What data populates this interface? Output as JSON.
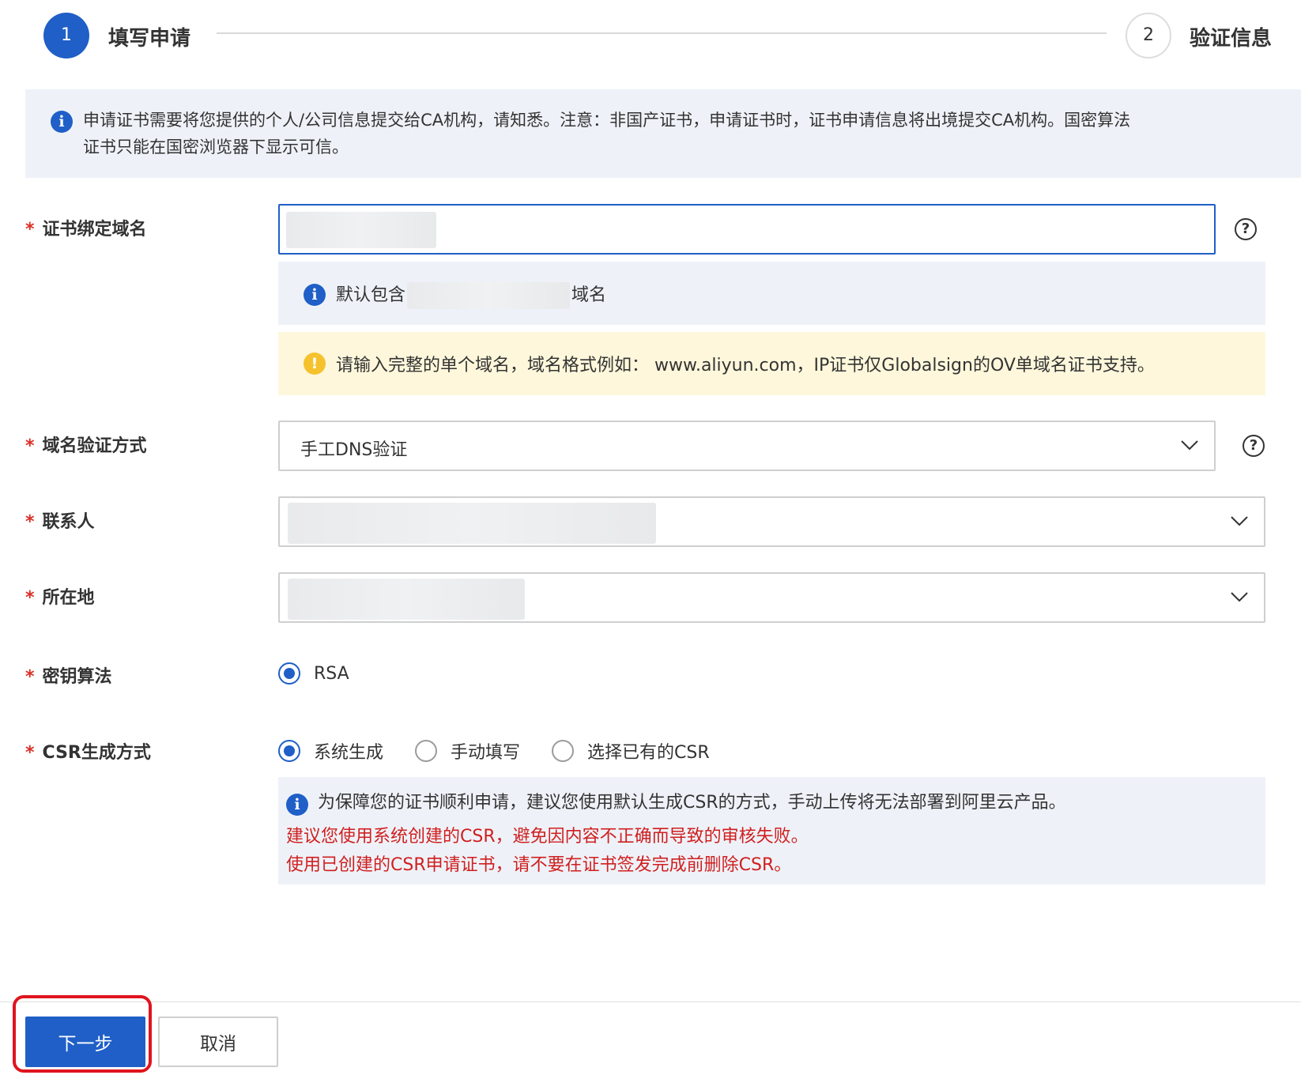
{
  "steps": [
    {
      "number": "1",
      "title": "填写申请"
    },
    {
      "number": "2",
      "title": "验证信息"
    }
  ],
  "top_notice": {
    "line1": "申请证书需要将您提供的个人/公司信息提交给CA机构，请知悉。注意：非国产证书，申请证书时，证书申请信息将出境提交CA机构。国密算法",
    "line2": "证书只能在国密浏览器下显示可信。"
  },
  "form": {
    "required_mark": "*",
    "domain": {
      "label": "证书绑定域名",
      "note_info_prefix": "默认包含",
      "note_info_suffix": "域名",
      "note_warn": "请输入完整的单个域名，域名格式例如： www.aliyun.com，IP证书仅Globalsign的OV单域名证书支持。"
    },
    "verify_method": {
      "label": "域名验证方式",
      "value": "手工DNS验证"
    },
    "contact": {
      "label": "联系人"
    },
    "location": {
      "label": "所在地"
    },
    "key_algorithm": {
      "label": "密钥算法",
      "options": [
        "RSA"
      ],
      "selected": "RSA"
    },
    "csr": {
      "label": "CSR生成方式",
      "options": [
        "系统生成",
        "手动填写",
        "选择已有的CSR"
      ],
      "selected": "系统生成",
      "note_line1": "为保障您的证书顺利申请，建议您使用默认生成CSR的方式，手动上传将无法部署到阿里云产品。",
      "note_line2": "建议您使用系统创建的CSR，避免因内容不正确而导致的审核失败。",
      "note_line3": "使用已创建的CSR申请证书，请不要在证书签发完成前删除CSR。"
    }
  },
  "footer": {
    "next_label": "下一步",
    "cancel_label": "取消"
  },
  "colors": {
    "primary": "#1f5fc7",
    "required": "#d93026",
    "warning_text_red": "#d01f1f",
    "highlight": "#e0141e"
  }
}
